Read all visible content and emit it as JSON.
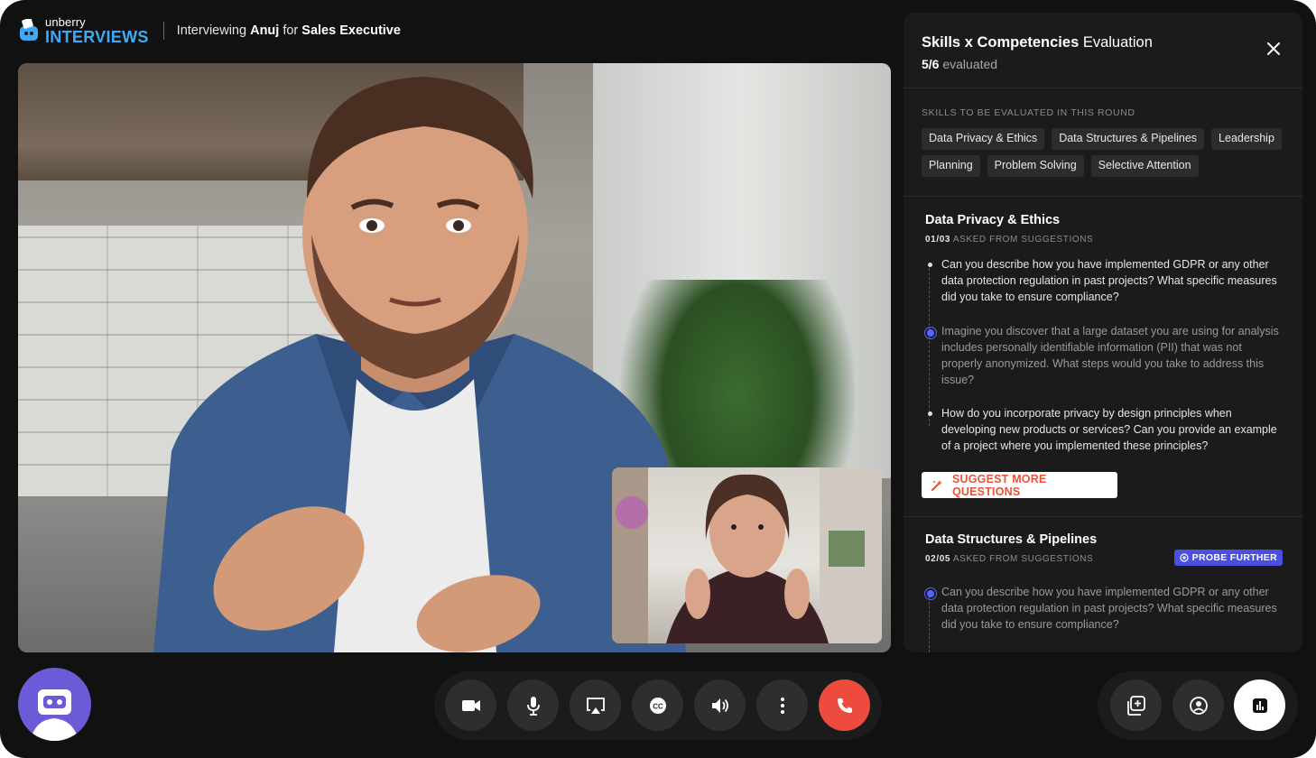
{
  "brand": {
    "small": "unberry",
    "big": "INTERVIEWS"
  },
  "header": {
    "prefix": "Interviewing ",
    "candidate": "Anuj",
    "middle": " for ",
    "role": "Sales Executive"
  },
  "panel": {
    "title_bold": "Skills x Competencies",
    "title_rest": " Evaluation",
    "evaluated_count": "5/6",
    "evaluated_label": " evaluated",
    "skills_label": "SKILLS TO BE EVALUATED IN THIS ROUND",
    "skills": [
      "Data Privacy & Ethics",
      "Data Structures & Pipelines",
      "Leadership",
      "Planning",
      "Problem Solving",
      "Selective Attention"
    ],
    "sections": [
      {
        "title": "Data Privacy & Ethics",
        "count": "01/03",
        "meta": " ASKED FROM SUGGESTIONS",
        "questions": [
          {
            "text": "Can you describe how you have implemented GDPR or any other data protection regulation in past projects? What specific measures did you take to ensure compliance?",
            "state": "pending"
          },
          {
            "text": "Imagine you discover that a large dataset you are using for analysis includes personally identifiable information (PII) that was not properly anonymized. What steps would you take to address this issue?",
            "state": "asked"
          },
          {
            "text": "How do you incorporate privacy by design principles when developing new products or services? Can you provide an example of a project where you implemented these principles?",
            "state": "pending"
          }
        ],
        "suggest_label": "SUGGEST MORE QUESTIONS"
      },
      {
        "title": "Data Structures & Pipelines",
        "count": "02/05",
        "meta": " ASKED FROM SUGGESTIONS",
        "badge": "PROBE FURTHER",
        "questions": [
          {
            "text": "Can you describe how you have implemented GDPR or any other data protection regulation in past projects? What specific measures did you take to ensure compliance?",
            "state": "asked"
          }
        ]
      }
    ]
  },
  "controls": [
    "video-camera-icon",
    "microphone-icon",
    "screen-share-icon",
    "closed-captions-icon",
    "speaker-icon",
    "more-options-icon",
    "end-call-icon"
  ],
  "side_controls": [
    "add-participant-icon",
    "record-icon",
    "evaluation-chart-icon"
  ],
  "colors": {
    "accent_blue": "#3fa9f5",
    "end_call": "#ec4b3e",
    "probe": "#4b4fe0",
    "suggest": "#e5533d"
  }
}
